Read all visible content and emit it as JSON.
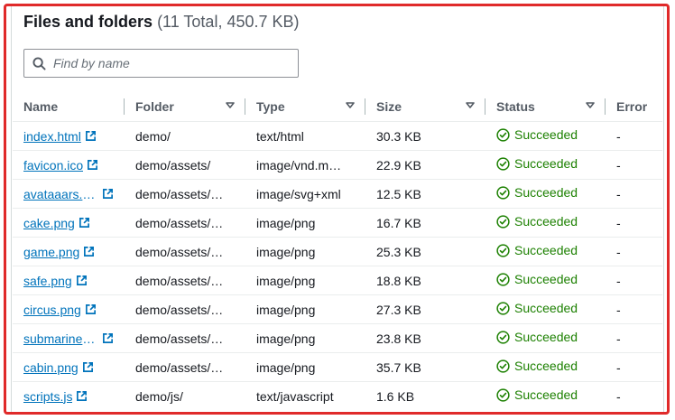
{
  "panel": {
    "title": "Files and folders",
    "count_text": "(11 Total, 450.7 KB)"
  },
  "search": {
    "placeholder": "Find by name",
    "value": ""
  },
  "columns": [
    {
      "label": "Name",
      "sortable": false
    },
    {
      "label": "Folder",
      "sortable": true
    },
    {
      "label": "Type",
      "sortable": true
    },
    {
      "label": "Size",
      "sortable": true
    },
    {
      "label": "Status",
      "sortable": true
    },
    {
      "label": "Error",
      "sortable": false
    }
  ],
  "rows": [
    {
      "name": "index.html",
      "folder": "demo/",
      "type": "text/html",
      "size": "30.3 KB",
      "status": "Succeeded",
      "error": "-"
    },
    {
      "name": "favicon.ico",
      "folder": "demo/assets/",
      "type": "image/vnd.m…",
      "size": "22.9 KB",
      "status": "Succeeded",
      "error": "-"
    },
    {
      "name": "avataaars.sv…",
      "folder": "demo/assets/…",
      "type": "image/svg+xml",
      "size": "12.5 KB",
      "status": "Succeeded",
      "error": "-"
    },
    {
      "name": "cake.png",
      "folder": "demo/assets/…",
      "type": "image/png",
      "size": "16.7 KB",
      "status": "Succeeded",
      "error": "-"
    },
    {
      "name": "game.png",
      "folder": "demo/assets/…",
      "type": "image/png",
      "size": "25.3 KB",
      "status": "Succeeded",
      "error": "-"
    },
    {
      "name": "safe.png",
      "folder": "demo/assets/…",
      "type": "image/png",
      "size": "18.8 KB",
      "status": "Succeeded",
      "error": "-"
    },
    {
      "name": "circus.png",
      "folder": "demo/assets/…",
      "type": "image/png",
      "size": "27.3 KB",
      "status": "Succeeded",
      "error": "-"
    },
    {
      "name": "submarine.p…",
      "folder": "demo/assets/…",
      "type": "image/png",
      "size": "23.8 KB",
      "status": "Succeeded",
      "error": "-"
    },
    {
      "name": "cabin.png",
      "folder": "demo/assets/…",
      "type": "image/png",
      "size": "35.7 KB",
      "status": "Succeeded",
      "error": "-"
    },
    {
      "name": "scripts.js",
      "folder": "demo/js/",
      "type": "text/javascript",
      "size": "1.6 KB",
      "status": "Succeeded",
      "error": "-"
    }
  ],
  "colors": {
    "link": "#0073bb",
    "success": "#1d8102",
    "highlight_frame": "#e02a2a"
  },
  "icons": {
    "search": "search-icon",
    "external": "external-link-icon",
    "sort": "caret-down-icon",
    "success": "check-circle-icon"
  }
}
